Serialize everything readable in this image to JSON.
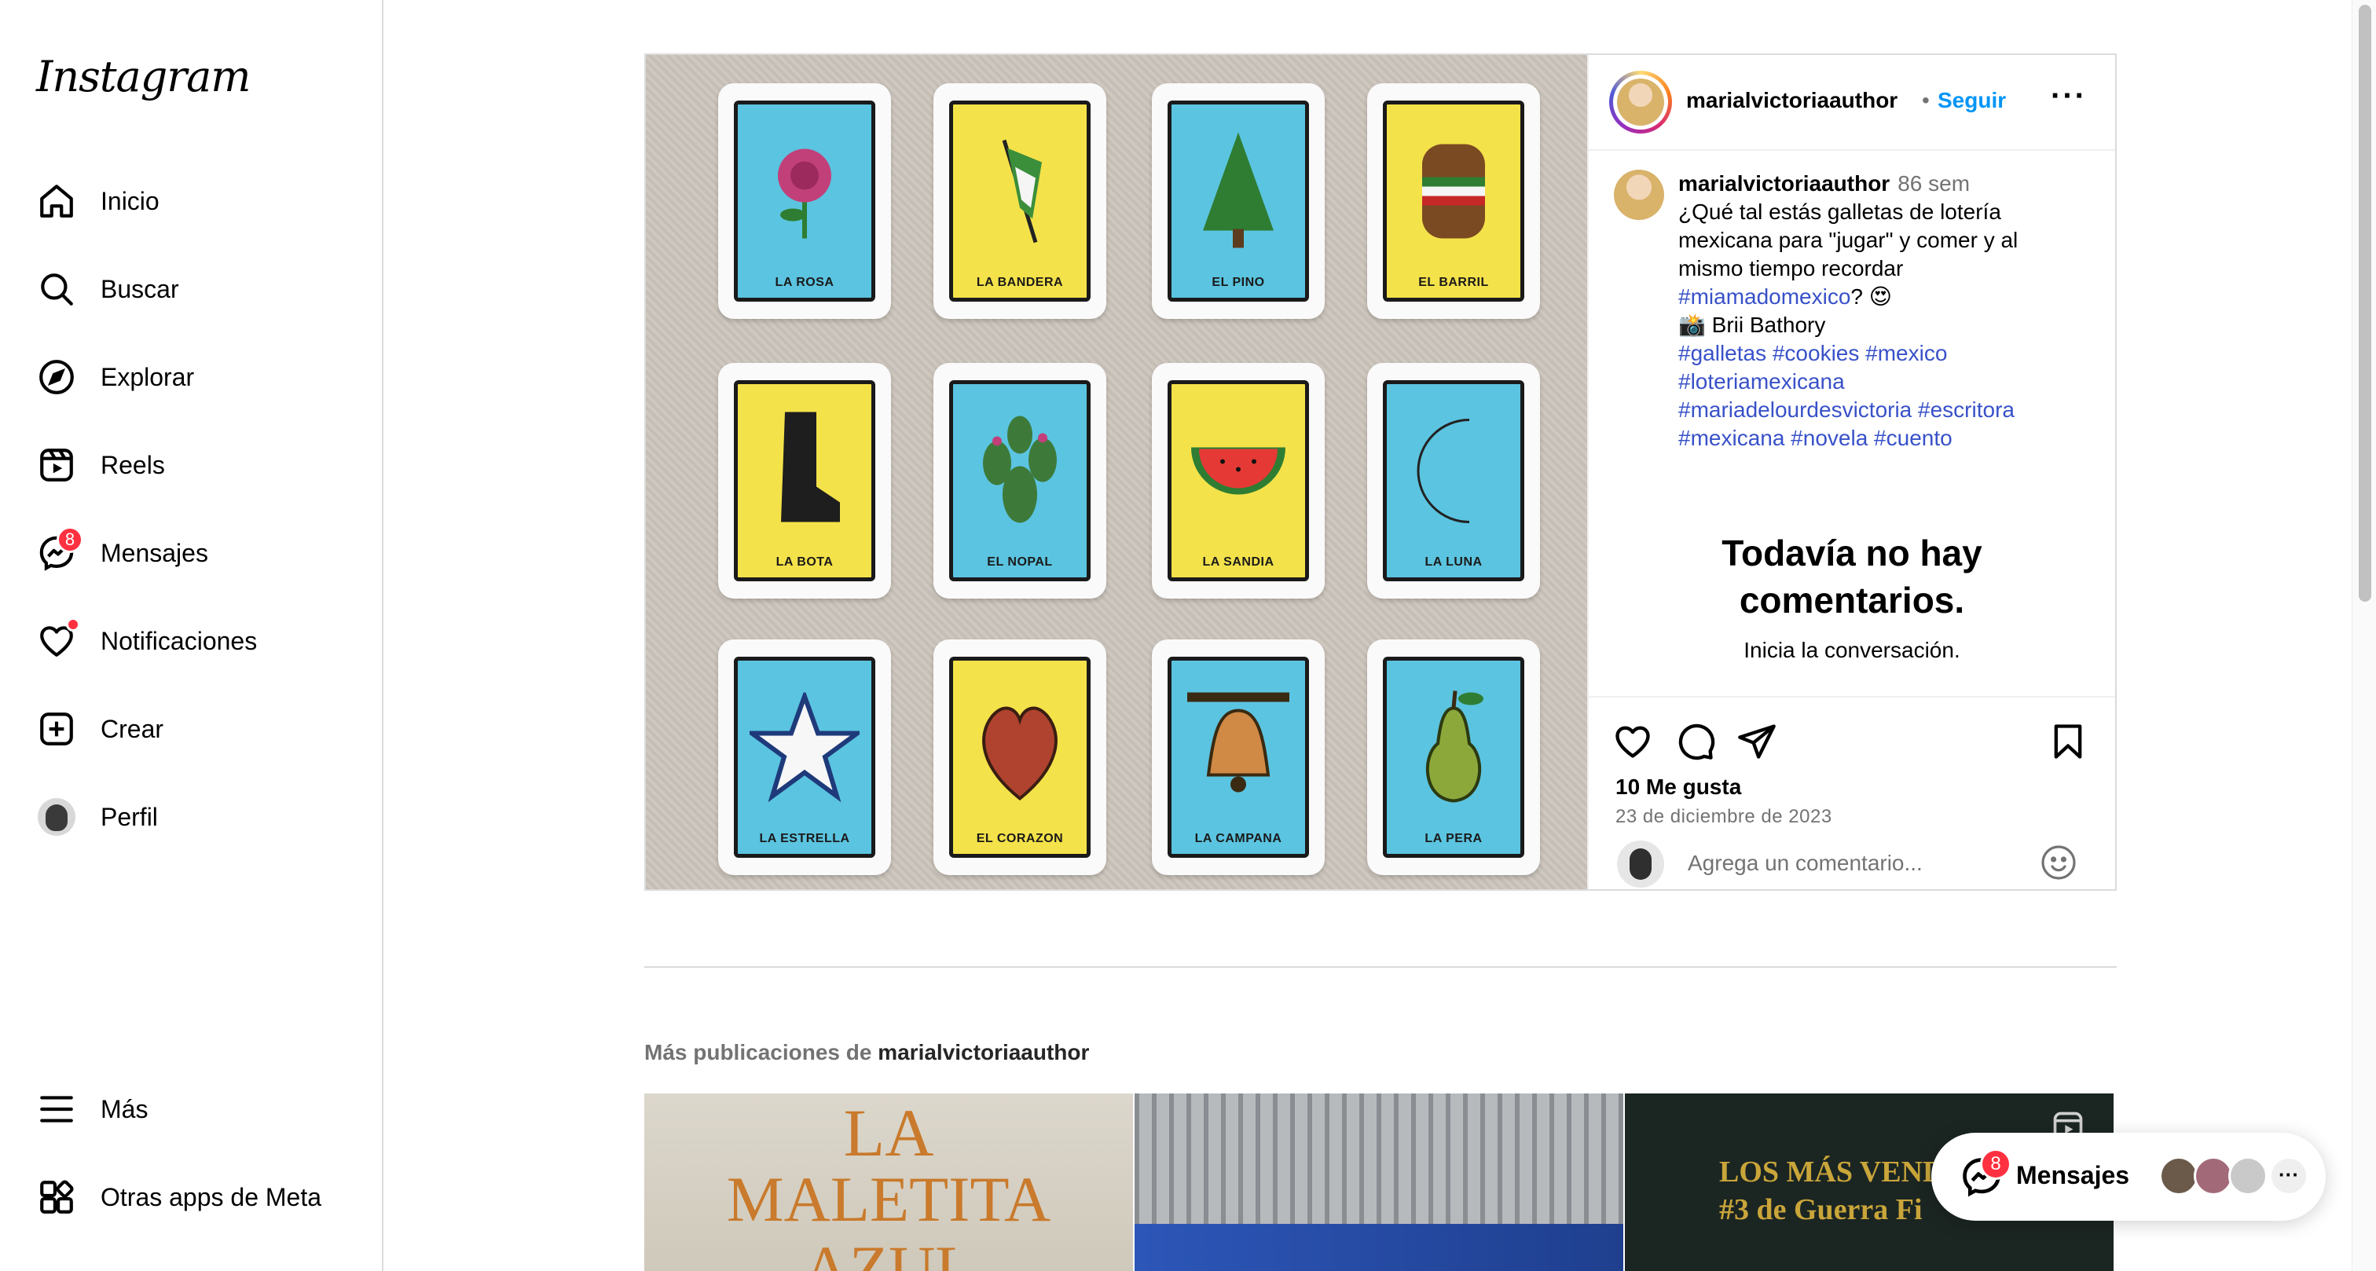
{
  "app": {
    "logo": "Instagram"
  },
  "sidebar": {
    "items": [
      {
        "label": "Inicio",
        "icon": "home-icon"
      },
      {
        "label": "Buscar",
        "icon": "search-icon"
      },
      {
        "label": "Explorar",
        "icon": "compass-icon"
      },
      {
        "label": "Reels",
        "icon": "reels-icon"
      },
      {
        "label": "Mensajes",
        "icon": "messenger-icon",
        "badge": "8"
      },
      {
        "label": "Notificaciones",
        "icon": "heart-icon",
        "dot": true
      },
      {
        "label": "Crear",
        "icon": "plus-square-icon"
      },
      {
        "label": "Perfil",
        "icon": "avatar"
      }
    ],
    "bottom": [
      {
        "label": "Más",
        "icon": "menu-icon"
      },
      {
        "label": "Otras apps de Meta",
        "icon": "meta-apps-icon"
      }
    ]
  },
  "post": {
    "author": "marialvictoriaauthor",
    "separator": "•",
    "follow": "Seguir",
    "more": "···",
    "time": "86 sem",
    "caption_lines": [
      "¿Qué tal estás galletas de lotería",
      "mexicana para \"jugar\" y comer y al",
      "mismo tiempo recordar"
    ],
    "caption_tag_line": {
      "tag": "#miamadomexico",
      "suffix": "? 😍"
    },
    "credit": "📸 Brii Bathory",
    "hashtags": [
      "#galletas #cookies #mexico",
      "#loteriamexicana",
      "#mariadelourdesvictoria #escritora",
      "#mexicana #novela #cuento"
    ],
    "empty_title": "Todavía no hay comentarios.",
    "empty_sub": "Inicia la conversación.",
    "likes": "10 Me gusta",
    "date": "23 de diciembre de 2023",
    "comment_placeholder": "Agrega un comentario...",
    "cards": [
      {
        "label": "LA ROSA",
        "bg": "#5bc4e0"
      },
      {
        "label": "LA BANDERA",
        "bg": "#f4e24a"
      },
      {
        "label": "EL PINO",
        "bg": "#5bc4e0"
      },
      {
        "label": "EL BARRIL",
        "bg": "#f4e24a"
      },
      {
        "label": "LA BOTA",
        "bg": "#f4e24a"
      },
      {
        "label": "EL NOPAL",
        "bg": "#5bc4e0"
      },
      {
        "label": "LA SANDIA",
        "bg": "#f4e24a"
      },
      {
        "label": "LA LUNA",
        "bg": "#5bc4e0"
      },
      {
        "label": "LA ESTRELLA",
        "bg": "#5bc4e0"
      },
      {
        "label": "EL CORAZON",
        "bg": "#f4e24a"
      },
      {
        "label": "LA CAMPANA",
        "bg": "#5bc4e0"
      },
      {
        "label": "LA PERA",
        "bg": "#5bc4e0"
      }
    ]
  },
  "more_posts": {
    "prefix": "Más publicaciones de",
    "author": "marialvictoriaauthor",
    "thumb1_line1": "LA",
    "thumb1_line2": "MALETITA",
    "thumb1_line3": "AZUL",
    "thumb3_line1": "LOS MÁS VEND",
    "thumb3_line2": "#3 de Guerra Fi"
  },
  "messages_pill": {
    "label": "Mensajes",
    "badge": "8",
    "more": "···"
  },
  "colors": {
    "accent": "#0095f6",
    "badge": "#ff3040",
    "hashtag": "#3851c8"
  }
}
